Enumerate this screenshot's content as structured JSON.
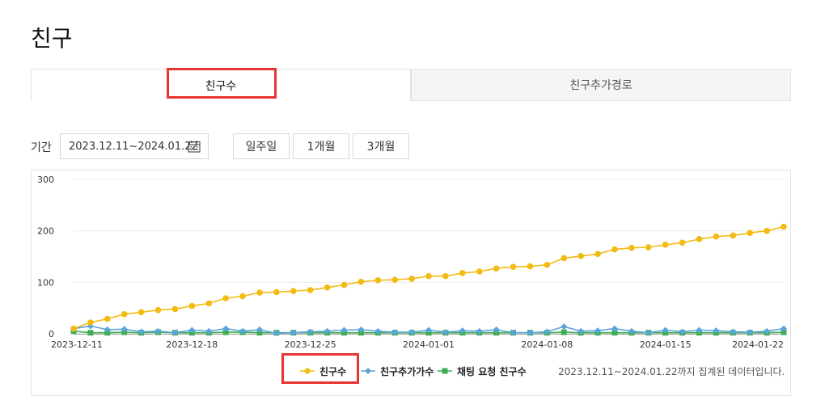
{
  "page": {
    "title": "친구"
  },
  "tabs": [
    {
      "label": "친구수",
      "active": true
    },
    {
      "label": "친구추가경로",
      "active": false
    }
  ],
  "filter": {
    "label": "기간",
    "date_range": "2023.12.11~2024.01.22",
    "calendar_icon": "calendar-icon",
    "buttons": [
      "일주일",
      "1개월",
      "3개월"
    ]
  },
  "colors": {
    "friends": "#f2bb13",
    "added": "#5ba4e0",
    "chat": "#3fae52",
    "highlight": "#e93434"
  },
  "chart_data": {
    "type": "line",
    "x": [
      "2023-12-11",
      "2023-12-12",
      "2023-12-13",
      "2023-12-14",
      "2023-12-15",
      "2023-12-16",
      "2023-12-17",
      "2023-12-18",
      "2023-12-19",
      "2023-12-20",
      "2023-12-21",
      "2023-12-22",
      "2023-12-23",
      "2023-12-24",
      "2023-12-25",
      "2023-12-26",
      "2023-12-27",
      "2023-12-28",
      "2023-12-29",
      "2023-12-30",
      "2023-12-31",
      "2024-01-01",
      "2024-01-02",
      "2024-01-03",
      "2024-01-04",
      "2024-01-05",
      "2024-01-06",
      "2024-01-07",
      "2024-01-08",
      "2024-01-09",
      "2024-01-10",
      "2024-01-11",
      "2024-01-12",
      "2024-01-13",
      "2024-01-14",
      "2024-01-15",
      "2024-01-16",
      "2024-01-17",
      "2024-01-18",
      "2024-01-19",
      "2024-01-20",
      "2024-01-21",
      "2024-01-22"
    ],
    "x_tick_labels": [
      "2023-12-11",
      "2023-12-18",
      "2023-12-25",
      "2024-01-01",
      "2024-01-08",
      "2024-01-15",
      "2024-01-22"
    ],
    "ylim": [
      0,
      300
    ],
    "y_ticks": [
      0,
      100,
      200,
      300
    ],
    "grid": true,
    "series": [
      {
        "name": "친구수",
        "values": [
          10,
          22,
          29,
          38,
          42,
          46,
          48,
          54,
          59,
          69,
          73,
          80,
          81,
          83,
          85,
          90,
          95,
          101,
          104,
          105,
          107,
          112,
          112,
          118,
          121,
          127,
          130,
          131,
          134,
          147,
          151,
          155,
          164,
          167,
          168,
          173,
          177,
          184,
          189,
          191,
          196,
          200,
          208
        ]
      },
      {
        "name": "친구추가가수",
        "values": [
          10,
          15,
          8,
          9,
          4,
          5,
          2,
          7,
          5,
          10,
          5,
          8,
          1,
          2,
          4,
          5,
          7,
          8,
          5,
          3,
          3,
          7,
          3,
          6,
          5,
          8,
          2,
          2,
          4,
          14,
          5,
          6,
          10,
          5,
          2,
          7,
          4,
          7,
          6,
          4,
          3,
          5,
          10
        ]
      },
      {
        "name": "채팅 요청 친구수",
        "values": [
          5,
          2,
          2,
          3,
          2,
          3,
          2,
          2,
          2,
          3,
          3,
          2,
          2,
          2,
          2,
          2,
          2,
          2,
          2,
          2,
          2,
          2,
          2,
          2,
          2,
          2,
          2,
          2,
          2,
          3,
          2,
          2,
          2,
          2,
          2,
          2,
          2,
          2,
          2,
          2,
          2,
          2,
          3
        ]
      }
    ]
  },
  "legend_note": "2023.12.11~2024.01.22까지 집계된 데이터입니다."
}
